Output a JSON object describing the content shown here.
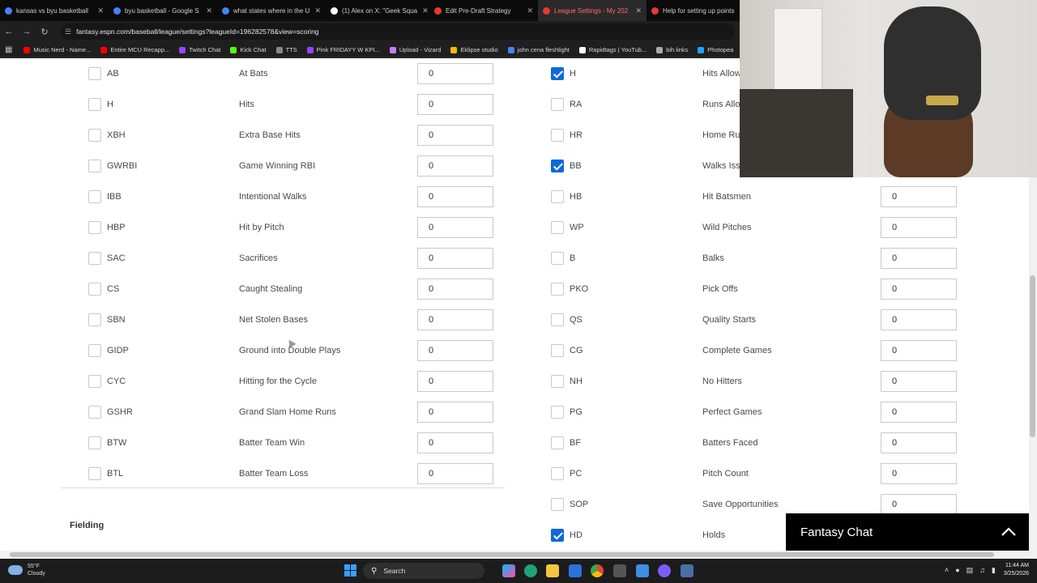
{
  "browser": {
    "tabs": [
      {
        "title": "kansas vs byu basketball",
        "color": "#4285f4",
        "active": false
      },
      {
        "title": "byu basketball - Google S",
        "color": "#4285f4",
        "active": false
      },
      {
        "title": "what states where in the U",
        "color": "#4285f4",
        "active": false
      },
      {
        "title": "(1) Alex on X: \"Geek Squa",
        "color": "#ffffff",
        "active": false
      },
      {
        "title": "Edit Pre-Draft Strategy",
        "color": "#e53935",
        "active": false
      },
      {
        "title": "League Settings - My 202",
        "color": "#e53935",
        "active": true
      },
      {
        "title": "Help for setting up points",
        "color": "#e53935",
        "active": false
      }
    ],
    "url": "fantasy.espn.com/baseball/league/settings?leagueId=196282578&view=scoring",
    "bookmarks": [
      {
        "label": "Music Nerd - Name...",
        "color": "#ff0000"
      },
      {
        "label": "Entire MCU Recapp...",
        "color": "#ff0000"
      },
      {
        "label": "Twitch Chat",
        "color": "#9146ff"
      },
      {
        "label": "Kick Chat",
        "color": "#53fc18"
      },
      {
        "label": "TTS",
        "color": "#888888"
      },
      {
        "label": "Pink FRIDAYY W KPI...",
        "color": "#9146ff"
      },
      {
        "label": "Upload - Vizard",
        "color": "#c77dff"
      },
      {
        "label": "Eklipse studio",
        "color": "#ffb703"
      },
      {
        "label": "john cena fleshlight",
        "color": "#4285f4"
      },
      {
        "label": "Rapidtags | YouTub...",
        "color": "#ffffff"
      },
      {
        "label": "bih links",
        "color": "#aaaaaa"
      },
      {
        "label": "Photopea",
        "color": "#1fa2ff"
      }
    ]
  },
  "batting": [
    {
      "abbr": "AB",
      "name": "At Bats",
      "value": "0",
      "checked": false
    },
    {
      "abbr": "H",
      "name": "Hits",
      "value": "0",
      "checked": false
    },
    {
      "abbr": "XBH",
      "name": "Extra Base Hits",
      "value": "0",
      "checked": false
    },
    {
      "abbr": "GWRBI",
      "name": "Game Winning RBI",
      "value": "0",
      "checked": false
    },
    {
      "abbr": "IBB",
      "name": "Intentional Walks",
      "value": "0",
      "checked": false
    },
    {
      "abbr": "HBP",
      "name": "Hit by Pitch",
      "value": "0",
      "checked": false
    },
    {
      "abbr": "SAC",
      "name": "Sacrifices",
      "value": "0",
      "checked": false
    },
    {
      "abbr": "CS",
      "name": "Caught Stealing",
      "value": "0",
      "checked": false
    },
    {
      "abbr": "SBN",
      "name": "Net Stolen Bases",
      "value": "0",
      "checked": false
    },
    {
      "abbr": "GIDP",
      "name": "Ground into Double Plays",
      "value": "0",
      "checked": false
    },
    {
      "abbr": "CYC",
      "name": "Hitting for the Cycle",
      "value": "0",
      "checked": false
    },
    {
      "abbr": "GSHR",
      "name": "Grand Slam Home Runs",
      "value": "0",
      "checked": false
    },
    {
      "abbr": "BTW",
      "name": "Batter Team Win",
      "value": "0",
      "checked": false
    },
    {
      "abbr": "BTL",
      "name": "Batter Team Loss",
      "value": "0",
      "checked": false
    }
  ],
  "pitching": [
    {
      "abbr": "H",
      "name": "Hits Allow",
      "value": "",
      "checked": true
    },
    {
      "abbr": "RA",
      "name": "Runs Allo",
      "value": "",
      "checked": false
    },
    {
      "abbr": "HR",
      "name": "Home Ru",
      "value": "",
      "checked": false
    },
    {
      "abbr": "BB",
      "name": "Walks Iss",
      "value": "",
      "checked": true
    },
    {
      "abbr": "HB",
      "name": "Hit Batsmen",
      "value": "0",
      "checked": false
    },
    {
      "abbr": "WP",
      "name": "Wild Pitches",
      "value": "0",
      "checked": false
    },
    {
      "abbr": "B",
      "name": "Balks",
      "value": "0",
      "checked": false
    },
    {
      "abbr": "PKO",
      "name": "Pick Offs",
      "value": "0",
      "checked": false
    },
    {
      "abbr": "QS",
      "name": "Quality Starts",
      "value": "0",
      "checked": false
    },
    {
      "abbr": "CG",
      "name": "Complete Games",
      "value": "0",
      "checked": false
    },
    {
      "abbr": "NH",
      "name": "No Hitters",
      "value": "0",
      "checked": false
    },
    {
      "abbr": "PG",
      "name": "Perfect Games",
      "value": "0",
      "checked": false
    },
    {
      "abbr": "BF",
      "name": "Batters Faced",
      "value": "0",
      "checked": false
    },
    {
      "abbr": "PC",
      "name": "Pitch Count",
      "value": "0",
      "checked": false
    },
    {
      "abbr": "SOP",
      "name": "Save Opportunities",
      "value": "0",
      "checked": false
    },
    {
      "abbr": "HD",
      "name": "Holds",
      "value": "",
      "checked": true
    }
  ],
  "section": {
    "fielding": "Fielding"
  },
  "chat": {
    "label": "Fantasy Chat"
  },
  "taskbar": {
    "weather_temp": "55°F",
    "weather_desc": "Cloudy",
    "search": "Search",
    "time": "11:44 AM",
    "date": "3/25/2026"
  }
}
